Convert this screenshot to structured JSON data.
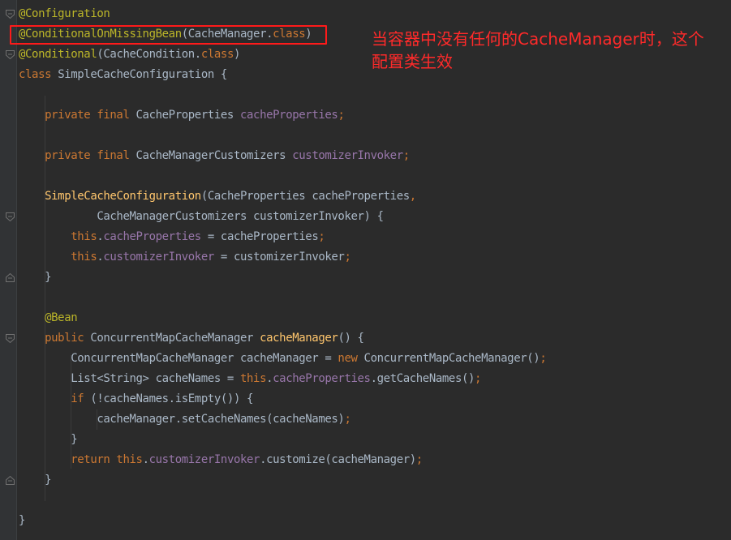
{
  "annotation": {
    "text": "当容器中没有任何的CacheManager时，这个配置类生效",
    "color": "#ff2a2a"
  },
  "code_lines": [
    {
      "tokens": [
        {
          "t": "@Configuration",
          "c": "ann"
        }
      ]
    },
    {
      "tokens": [
        {
          "t": "@ConditionalOnMissingBean",
          "c": "ann"
        },
        {
          "t": "(CacheManager.",
          "c": "dflt"
        },
        {
          "t": "class",
          "c": "kw"
        },
        {
          "t": ")",
          "c": "dflt"
        }
      ]
    },
    {
      "tokens": [
        {
          "t": "@Conditional",
          "c": "ann"
        },
        {
          "t": "(CacheCondition.",
          "c": "dflt"
        },
        {
          "t": "class",
          "c": "kw"
        },
        {
          "t": ")",
          "c": "dflt"
        }
      ]
    },
    {
      "tokens": [
        {
          "t": "class ",
          "c": "kw"
        },
        {
          "t": "SimpleCacheConfiguration {",
          "c": "dflt"
        }
      ]
    },
    {
      "tokens": []
    },
    {
      "tokens": [
        {
          "t": "    private final ",
          "c": "kw"
        },
        {
          "t": "CacheProperties ",
          "c": "dflt"
        },
        {
          "t": "cacheProperties",
          "c": "fld"
        },
        {
          "t": ";",
          "c": "kw"
        }
      ]
    },
    {
      "tokens": []
    },
    {
      "tokens": [
        {
          "t": "    private final ",
          "c": "kw"
        },
        {
          "t": "CacheManagerCustomizers ",
          "c": "dflt"
        },
        {
          "t": "customizerInvoker",
          "c": "fld"
        },
        {
          "t": ";",
          "c": "kw"
        }
      ]
    },
    {
      "tokens": []
    },
    {
      "tokens": [
        {
          "t": "    ",
          "c": "dflt"
        },
        {
          "t": "SimpleCacheConfiguration",
          "c": "mth"
        },
        {
          "t": "(CacheProperties cacheProperties",
          "c": "dflt"
        },
        {
          "t": ",",
          "c": "kw"
        }
      ]
    },
    {
      "tokens": [
        {
          "t": "            CacheManagerCustomizers customizerInvoker) {",
          "c": "dflt"
        }
      ]
    },
    {
      "tokens": [
        {
          "t": "        ",
          "c": "dflt"
        },
        {
          "t": "this",
          "c": "kw"
        },
        {
          "t": ".",
          "c": "dflt"
        },
        {
          "t": "cacheProperties",
          "c": "fld"
        },
        {
          "t": " = cacheProperties",
          "c": "dflt"
        },
        {
          "t": ";",
          "c": "kw"
        }
      ]
    },
    {
      "tokens": [
        {
          "t": "        ",
          "c": "dflt"
        },
        {
          "t": "this",
          "c": "kw"
        },
        {
          "t": ".",
          "c": "dflt"
        },
        {
          "t": "customizerInvoker",
          "c": "fld"
        },
        {
          "t": " = customizerInvoker",
          "c": "dflt"
        },
        {
          "t": ";",
          "c": "kw"
        }
      ]
    },
    {
      "tokens": [
        {
          "t": "    }",
          "c": "dflt"
        }
      ]
    },
    {
      "tokens": []
    },
    {
      "tokens": [
        {
          "t": "    @Bean",
          "c": "ann"
        }
      ]
    },
    {
      "tokens": [
        {
          "t": "    public ",
          "c": "kw"
        },
        {
          "t": "ConcurrentMapCacheManager ",
          "c": "dflt"
        },
        {
          "t": "cacheManager",
          "c": "mth"
        },
        {
          "t": "() {",
          "c": "dflt"
        }
      ]
    },
    {
      "tokens": [
        {
          "t": "        ConcurrentMapCacheManager cacheManager = ",
          "c": "dflt"
        },
        {
          "t": "new ",
          "c": "kw"
        },
        {
          "t": "ConcurrentMapCacheManager()",
          "c": "dflt"
        },
        {
          "t": ";",
          "c": "kw"
        }
      ]
    },
    {
      "tokens": [
        {
          "t": "        List<String> cacheNames = ",
          "c": "dflt"
        },
        {
          "t": "this",
          "c": "kw"
        },
        {
          "t": ".",
          "c": "dflt"
        },
        {
          "t": "cacheProperties",
          "c": "fld"
        },
        {
          "t": ".getCacheNames()",
          "c": "dflt"
        },
        {
          "t": ";",
          "c": "kw"
        }
      ]
    },
    {
      "tokens": [
        {
          "t": "        ",
          "c": "dflt"
        },
        {
          "t": "if ",
          "c": "kw"
        },
        {
          "t": "(!cacheNames.isEmpty()) {",
          "c": "dflt"
        }
      ]
    },
    {
      "tokens": [
        {
          "t": "            cacheManager.setCacheNames(cacheNames)",
          "c": "dflt"
        },
        {
          "t": ";",
          "c": "kw"
        }
      ]
    },
    {
      "tokens": [
        {
          "t": "        }",
          "c": "dflt"
        }
      ]
    },
    {
      "tokens": [
        {
          "t": "        ",
          "c": "dflt"
        },
        {
          "t": "return this",
          "c": "kw"
        },
        {
          "t": ".",
          "c": "dflt"
        },
        {
          "t": "customizerInvoker",
          "c": "fld"
        },
        {
          "t": ".customize(cacheManager)",
          "c": "dflt"
        },
        {
          "t": ";",
          "c": "kw"
        }
      ]
    },
    {
      "tokens": [
        {
          "t": "    }",
          "c": "dflt"
        }
      ]
    },
    {
      "tokens": []
    },
    {
      "tokens": [
        {
          "t": "}",
          "c": "dflt"
        }
      ]
    }
  ],
  "fold_markers": [
    {
      "line": 0,
      "kind": "open"
    },
    {
      "line": 2,
      "kind": "open"
    },
    {
      "line": 10,
      "kind": "open"
    },
    {
      "line": 13,
      "kind": "close"
    },
    {
      "line": 16,
      "kind": "open"
    },
    {
      "line": 23,
      "kind": "close"
    }
  ]
}
